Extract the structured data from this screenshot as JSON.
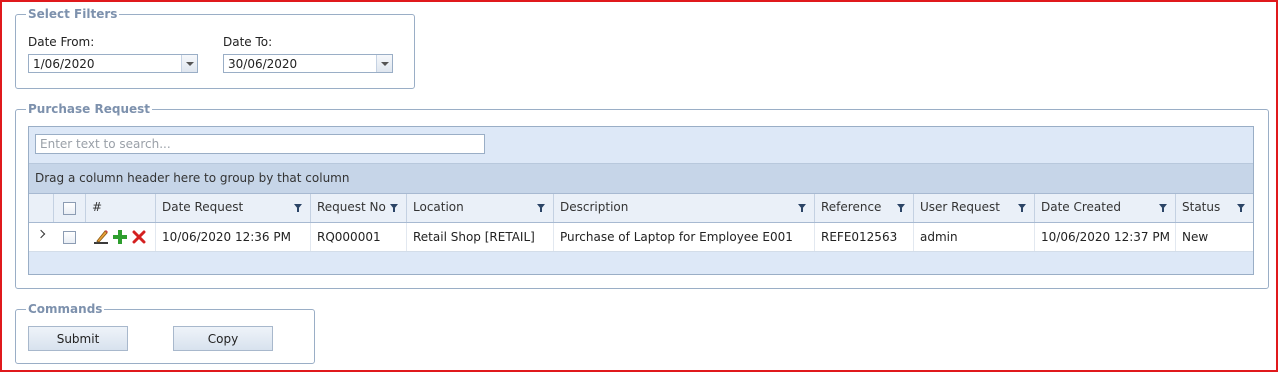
{
  "filters": {
    "legend": "Select Filters",
    "date_from_label": "Date From:",
    "date_from_value": "1/06/2020",
    "date_to_label": "Date To:",
    "date_to_value": "30/06/2020"
  },
  "purchase_request": {
    "legend": "Purchase Request",
    "search_placeholder": "Enter text to search...",
    "group_hint": "Drag a column header here to group by that column",
    "columns": {
      "hash": "#",
      "date_request": "Date Request",
      "request_no": "Request No",
      "location": "Location",
      "description": "Description",
      "reference": "Reference",
      "user_request": "User Request",
      "date_created": "Date Created",
      "status": "Status"
    },
    "rows": [
      {
        "date_request": "10/06/2020 12:36 PM",
        "request_no": "RQ000001",
        "location": "Retail Shop [RETAIL]",
        "description": "Purchase of Laptop for Employee E001",
        "reference": "REFE012563",
        "user_request": "admin",
        "date_created": "10/06/2020 12:37 PM",
        "status": "New"
      }
    ]
  },
  "commands": {
    "legend": "Commands",
    "submit_label": "Submit",
    "copy_label": "Copy"
  },
  "colors": {
    "frame_border": "#e0191c",
    "legend_text": "#7d91ad",
    "group_panel": "#c6d5e8",
    "add_icon": "#2e9e2e",
    "delete_icon": "#d42020"
  }
}
